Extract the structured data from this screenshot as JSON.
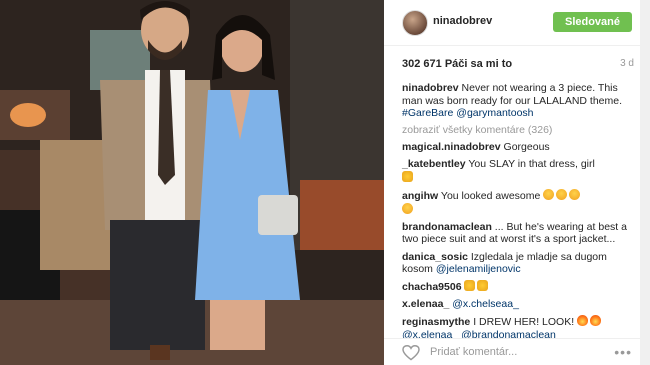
{
  "post": {
    "username": "ninadobrev",
    "follow_label": "Sledované",
    "likes": "302 671 Páči sa mi to",
    "age": "3 d",
    "caption": {
      "user": "ninadobrev",
      "text": "Never not wearing a 3 piece. This man was born ready for our LALALAND theme.",
      "hashtag": "#GareBare",
      "mention": "@garymantoosh"
    },
    "view_all": "zobraziť všetky komentáre (326)",
    "comments": [
      {
        "user": "magical.ninadobrev",
        "text": "Gorgeous"
      },
      {
        "user": "_katebentley",
        "text": "You SLAY in that dress, girl"
      },
      {
        "user": "angihw",
        "text": "You looked awesome"
      },
      {
        "user": "brandonamaclean",
        "text": "... But he's wearing at best a two piece suit and at worst it's a sport jacket..."
      },
      {
        "user": "danica_sosic",
        "text": "Izgledala je mladje sa dugom kosom",
        "mention": "@jelenamiljenovic"
      },
      {
        "user": "chacha9506",
        "text": ""
      },
      {
        "user": "x.elenaa_",
        "mention": "@x.chelseaa_"
      },
      {
        "user": "reginasmythe",
        "text": "I DREW HER! LOOK!",
        "mention": "@x.elenaa_ @brandonamaclean"
      }
    ],
    "comment_placeholder": "Pridať komentár..."
  },
  "icons": {
    "like": "heart-outline-icon",
    "more": "ellipsis-icon",
    "fire": "fire-emoji-icon",
    "heart_eyes": "heart-eyes-emoji-icon",
    "thumbs": "thumbs-up-emoji-icon"
  },
  "colors": {
    "follow_button": "#70c050",
    "link": "#003569"
  }
}
